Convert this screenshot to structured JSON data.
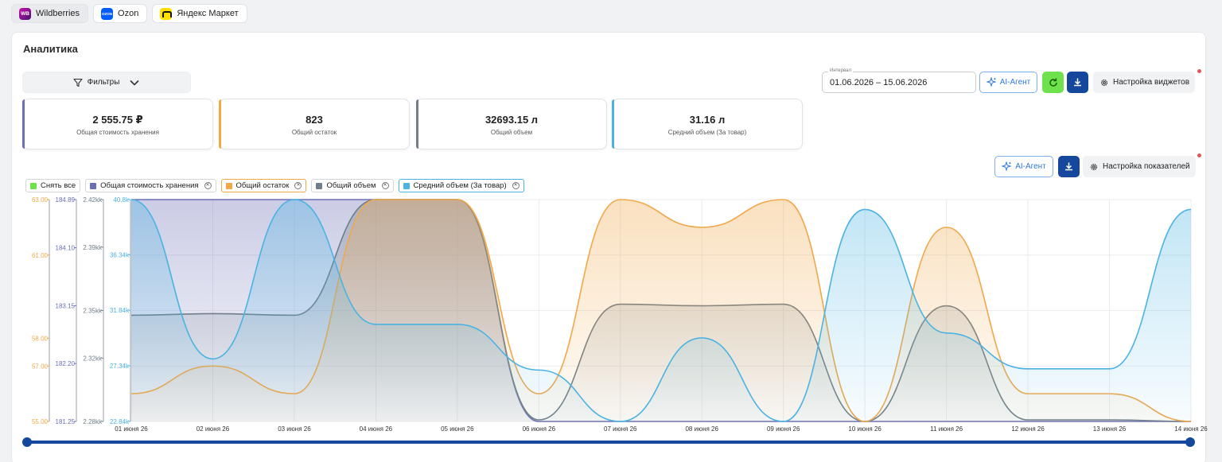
{
  "marketplaces": [
    {
      "label": "Wildberries",
      "logo": "WB"
    },
    {
      "label": "Ozon",
      "logo": "OZON"
    },
    {
      "label": "Яндекс Маркет",
      "logo": ""
    }
  ],
  "page": {
    "title": "Аналитика"
  },
  "filters": {
    "label": "Фильтры"
  },
  "kpis": [
    {
      "value": "2 555.75 ₽",
      "label": "Общая стоимость хранения",
      "color": "#6b6fb5"
    },
    {
      "value": "823",
      "label": "Общий остаток",
      "color": "#f0a84a"
    },
    {
      "value": "32693.15 л",
      "label": "Общий объем",
      "color": "#6f7e8a"
    },
    {
      "value": "31.16 л",
      "label": "Средний объем (За товар)",
      "color": "#4ab3e3"
    }
  ],
  "toolbar": {
    "interval_label": "Интервал",
    "interval_value": "01.06.2026 – 15.06.2026",
    "ai_agent": "AI-Агент",
    "widget_settings": "Настройка виджетов",
    "metric_settings": "Настройка показателей"
  },
  "legend": {
    "clear_all": "Снять все",
    "series": [
      {
        "name": "Общая стоимость хранения",
        "color": "#6b6fb5"
      },
      {
        "name": "Общий остаток",
        "color": "#f0a84a"
      },
      {
        "name": "Общий объем",
        "color": "#6f7e8a"
      },
      {
        "name": "Средний объем (За товар)",
        "color": "#4ab3e3"
      }
    ]
  },
  "chart_data": {
    "type": "area",
    "x": [
      "01 июня 26",
      "02 июня 26",
      "03 июня 26",
      "04 июня 26",
      "05 июня 26",
      "06 июня 26",
      "07 июня 26",
      "08 июня 26",
      "09 июня 26",
      "10 июня 26",
      "11 июня 26",
      "12 июня 26",
      "13 июня 26",
      "14 июня 26"
    ],
    "axes": [
      {
        "id": "a",
        "color": "#f0a84a",
        "ticks": [
          "55.00",
          "57.00",
          "58.00",
          "61.00",
          "63.00"
        ],
        "ylim": [
          55,
          63
        ]
      },
      {
        "id": "b",
        "color": "#6b6fb5",
        "ticks": [
          "181.25",
          "182.20",
          "183.15",
          "184.10",
          "184.89"
        ],
        "ylim": [
          181.25,
          184.89
        ]
      },
      {
        "id": "c",
        "color": "#6f7e8a",
        "ticks": [
          "2.28kk",
          "2.32kk",
          "2.35kk",
          "2.39kk",
          "2.42kk"
        ],
        "ylim": [
          2.28,
          2.42
        ]
      },
      {
        "id": "d",
        "color": "#4ab3e3",
        "ticks": [
          "22.84k",
          "27.34k",
          "31.84k",
          "36.34k",
          "40.8k"
        ],
        "ylim": [
          22.84,
          40.8
        ]
      }
    ],
    "series": [
      {
        "name": "Общая стоимость хранения",
        "axis": "b",
        "color": "#6b6fb5",
        "values": [
          184.89,
          184.89,
          184.89,
          184.89,
          184.89,
          181.25,
          181.25,
          181.25,
          181.25,
          181.25,
          181.25,
          181.25,
          181.25,
          181.25
        ]
      },
      {
        "name": "Общий остаток",
        "axis": "a",
        "color": "#f0a84a",
        "values": [
          56.0,
          57.0,
          56.0,
          63.0,
          63.0,
          56.0,
          63.0,
          62.0,
          63.0,
          55.0,
          62.0,
          56.0,
          56.0,
          55.0
        ]
      },
      {
        "name": "Общий объем",
        "axis": "c",
        "color": "#6f7e8a",
        "values": [
          2.347,
          2.348,
          2.347,
          2.42,
          2.42,
          2.281,
          2.354,
          2.353,
          2.354,
          2.28,
          2.353,
          2.281,
          2.281,
          2.28
        ]
      },
      {
        "name": "Средний объем (За товар)",
        "axis": "d",
        "color": "#4ab3e3",
        "values": [
          40.8,
          27.9,
          40.8,
          30.7,
          30.7,
          27.0,
          22.84,
          29.6,
          22.84,
          40.0,
          30.0,
          27.1,
          27.1,
          40.0
        ]
      }
    ],
    "grid": true
  }
}
